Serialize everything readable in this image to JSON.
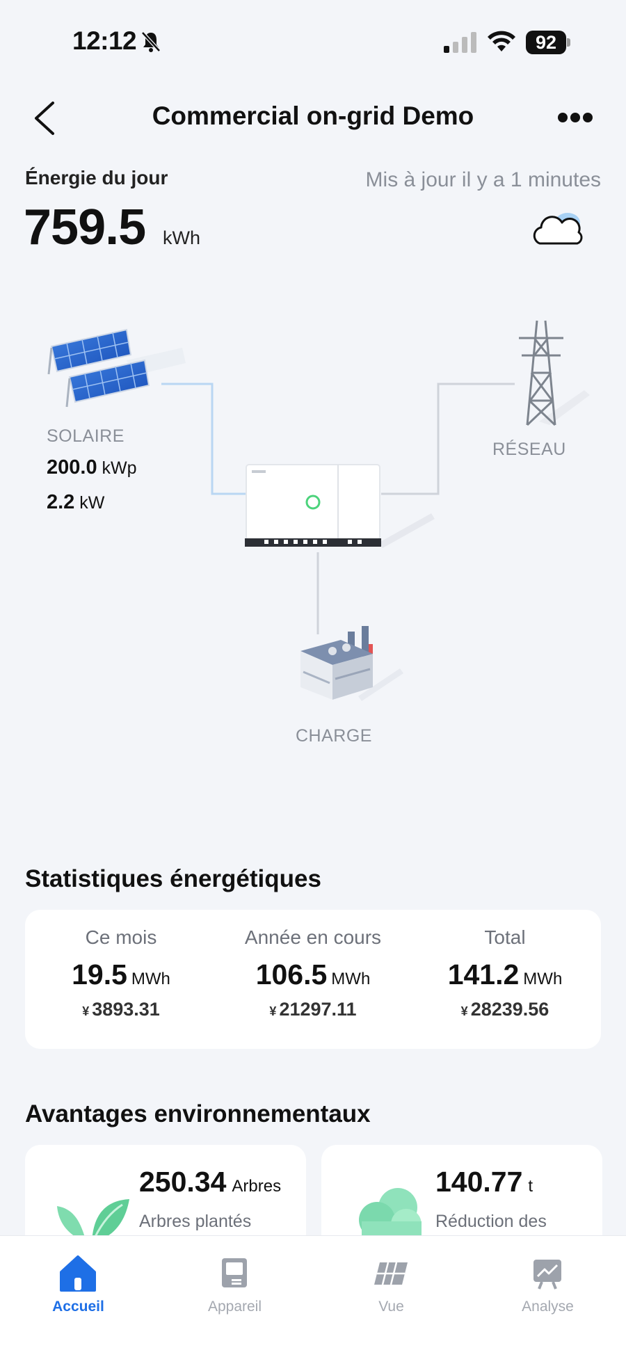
{
  "status_bar": {
    "time": "12:12",
    "battery": "92"
  },
  "header": {
    "title": "Commercial on-grid Demo"
  },
  "daily_energy": {
    "label": "Énergie du jour",
    "value": "759.5",
    "unit": "kWh",
    "updated": "Mis  à jour il y a 1 minutes"
  },
  "flow": {
    "solar": {
      "label": "SOLAIRE",
      "capacity_value": "200.0",
      "capacity_unit": "kWp",
      "power_value": "2.2",
      "power_unit": "kW"
    },
    "grid": {
      "label": "RÉSEAU"
    },
    "load": {
      "label": "CHARGE"
    }
  },
  "stats": {
    "title": "Statistiques énergétiques",
    "items": [
      {
        "label": "Ce mois",
        "value": "19.5",
        "unit": "MWh",
        "currency": "¥",
        "amount": "3893.31"
      },
      {
        "label": "Année en cours",
        "value": "106.5",
        "unit": "MWh",
        "currency": "¥",
        "amount": "21297.11"
      },
      {
        "label": "Total",
        "value": "141.2",
        "unit": "MWh",
        "currency": "¥",
        "amount": "28239.56"
      }
    ]
  },
  "environment": {
    "title": "Avantages environnementaux",
    "items": [
      {
        "value": "250.34",
        "unit": "Arbres",
        "desc": "Arbres plantés",
        "icon": "tree-leaf-icon"
      },
      {
        "value": "140.77",
        "unit": "t",
        "desc": "Réduction des",
        "icon": "co2-cloud-icon"
      }
    ]
  },
  "nav": {
    "items": [
      {
        "label": "Accueil",
        "icon": "home-icon",
        "active": true
      },
      {
        "label": "Appareil",
        "icon": "device-icon",
        "active": false
      },
      {
        "label": "Vue",
        "icon": "panel-view-icon",
        "active": false
      },
      {
        "label": "Analyse",
        "icon": "analysis-icon",
        "active": false
      }
    ]
  },
  "colors": {
    "accent": "#1e6fe6",
    "background": "#f3f5f9",
    "muted": "#8a8f98"
  }
}
